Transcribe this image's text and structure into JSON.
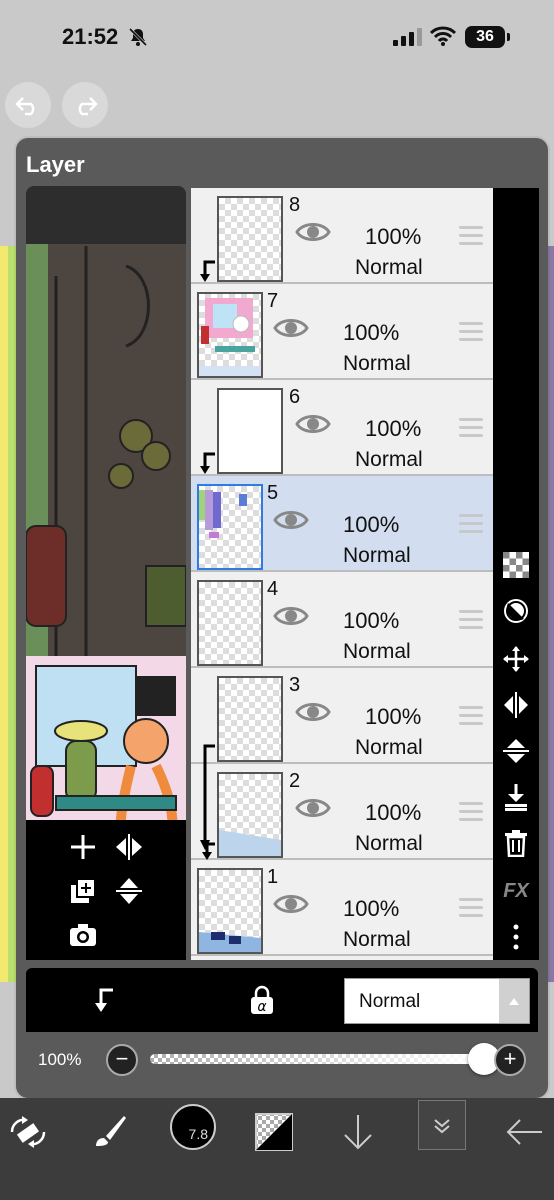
{
  "status_bar": {
    "time": "21:52",
    "battery": "36"
  },
  "panel": {
    "title": "Layer"
  },
  "layers": [
    {
      "num": "8",
      "opacity": "100%",
      "blend": "Normal",
      "clipped": true,
      "selected": false
    },
    {
      "num": "7",
      "opacity": "100%",
      "blend": "Normal",
      "clipped": false,
      "selected": false
    },
    {
      "num": "6",
      "opacity": "100%",
      "blend": "Normal",
      "clipped": true,
      "selected": false
    },
    {
      "num": "5",
      "opacity": "100%",
      "blend": "Normal",
      "clipped": false,
      "selected": true
    },
    {
      "num": "4",
      "opacity": "100%",
      "blend": "Normal",
      "clipped": false,
      "selected": false
    },
    {
      "num": "3",
      "opacity": "100%",
      "blend": "Normal",
      "clipped": true,
      "selected": false
    },
    {
      "num": "2",
      "opacity": "100%",
      "blend": "Normal",
      "clipped": true,
      "selected": false
    },
    {
      "num": "1",
      "opacity": "100%",
      "blend": "Normal",
      "clipped": false,
      "selected": false
    }
  ],
  "right_tools": {
    "fx_label": "FX"
  },
  "bottom_controls": {
    "blend_mode": "Normal",
    "opacity_label": "100%",
    "opacity_value": 1.0
  },
  "toolbar": {
    "brush_size": "7.8"
  },
  "colors": {
    "panel_bg": "#5a5a5a",
    "selected_row": "#d2deef",
    "selected_border": "#2f7be0"
  }
}
